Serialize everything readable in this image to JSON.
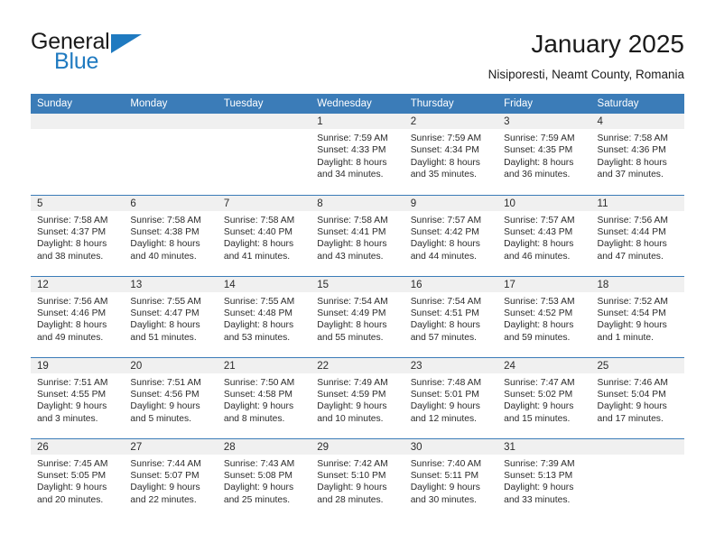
{
  "logo": {
    "word_top": "General",
    "word_bottom": "Blue",
    "flag_icon": "triangle-flag-icon",
    "accent_color": "#1f7ac0"
  },
  "header": {
    "title": "January 2025",
    "subtitle": "Nisiporesti, Neamt County, Romania"
  },
  "theme": {
    "header_blue": "#3b7cb8",
    "daynum_band": "#f0f0f0",
    "text": "#2b2b2b"
  },
  "calendar": {
    "weekday_headers": [
      "Sunday",
      "Monday",
      "Tuesday",
      "Wednesday",
      "Thursday",
      "Friday",
      "Saturday"
    ],
    "weeks": [
      [
        {
          "day": "",
          "lines": []
        },
        {
          "day": "",
          "lines": []
        },
        {
          "day": "",
          "lines": []
        },
        {
          "day": "1",
          "lines": [
            "Sunrise: 7:59 AM",
            "Sunset: 4:33 PM",
            "Daylight: 8 hours",
            "and 34 minutes."
          ]
        },
        {
          "day": "2",
          "lines": [
            "Sunrise: 7:59 AM",
            "Sunset: 4:34 PM",
            "Daylight: 8 hours",
            "and 35 minutes."
          ]
        },
        {
          "day": "3",
          "lines": [
            "Sunrise: 7:59 AM",
            "Sunset: 4:35 PM",
            "Daylight: 8 hours",
            "and 36 minutes."
          ]
        },
        {
          "day": "4",
          "lines": [
            "Sunrise: 7:58 AM",
            "Sunset: 4:36 PM",
            "Daylight: 8 hours",
            "and 37 minutes."
          ]
        }
      ],
      [
        {
          "day": "5",
          "lines": [
            "Sunrise: 7:58 AM",
            "Sunset: 4:37 PM",
            "Daylight: 8 hours",
            "and 38 minutes."
          ]
        },
        {
          "day": "6",
          "lines": [
            "Sunrise: 7:58 AM",
            "Sunset: 4:38 PM",
            "Daylight: 8 hours",
            "and 40 minutes."
          ]
        },
        {
          "day": "7",
          "lines": [
            "Sunrise: 7:58 AM",
            "Sunset: 4:40 PM",
            "Daylight: 8 hours",
            "and 41 minutes."
          ]
        },
        {
          "day": "8",
          "lines": [
            "Sunrise: 7:58 AM",
            "Sunset: 4:41 PM",
            "Daylight: 8 hours",
            "and 43 minutes."
          ]
        },
        {
          "day": "9",
          "lines": [
            "Sunrise: 7:57 AM",
            "Sunset: 4:42 PM",
            "Daylight: 8 hours",
            "and 44 minutes."
          ]
        },
        {
          "day": "10",
          "lines": [
            "Sunrise: 7:57 AM",
            "Sunset: 4:43 PM",
            "Daylight: 8 hours",
            "and 46 minutes."
          ]
        },
        {
          "day": "11",
          "lines": [
            "Sunrise: 7:56 AM",
            "Sunset: 4:44 PM",
            "Daylight: 8 hours",
            "and 47 minutes."
          ]
        }
      ],
      [
        {
          "day": "12",
          "lines": [
            "Sunrise: 7:56 AM",
            "Sunset: 4:46 PM",
            "Daylight: 8 hours",
            "and 49 minutes."
          ]
        },
        {
          "day": "13",
          "lines": [
            "Sunrise: 7:55 AM",
            "Sunset: 4:47 PM",
            "Daylight: 8 hours",
            "and 51 minutes."
          ]
        },
        {
          "day": "14",
          "lines": [
            "Sunrise: 7:55 AM",
            "Sunset: 4:48 PM",
            "Daylight: 8 hours",
            "and 53 minutes."
          ]
        },
        {
          "day": "15",
          "lines": [
            "Sunrise: 7:54 AM",
            "Sunset: 4:49 PM",
            "Daylight: 8 hours",
            "and 55 minutes."
          ]
        },
        {
          "day": "16",
          "lines": [
            "Sunrise: 7:54 AM",
            "Sunset: 4:51 PM",
            "Daylight: 8 hours",
            "and 57 minutes."
          ]
        },
        {
          "day": "17",
          "lines": [
            "Sunrise: 7:53 AM",
            "Sunset: 4:52 PM",
            "Daylight: 8 hours",
            "and 59 minutes."
          ]
        },
        {
          "day": "18",
          "lines": [
            "Sunrise: 7:52 AM",
            "Sunset: 4:54 PM",
            "Daylight: 9 hours",
            "and 1 minute."
          ]
        }
      ],
      [
        {
          "day": "19",
          "lines": [
            "Sunrise: 7:51 AM",
            "Sunset: 4:55 PM",
            "Daylight: 9 hours",
            "and 3 minutes."
          ]
        },
        {
          "day": "20",
          "lines": [
            "Sunrise: 7:51 AM",
            "Sunset: 4:56 PM",
            "Daylight: 9 hours",
            "and 5 minutes."
          ]
        },
        {
          "day": "21",
          "lines": [
            "Sunrise: 7:50 AM",
            "Sunset: 4:58 PM",
            "Daylight: 9 hours",
            "and 8 minutes."
          ]
        },
        {
          "day": "22",
          "lines": [
            "Sunrise: 7:49 AM",
            "Sunset: 4:59 PM",
            "Daylight: 9 hours",
            "and 10 minutes."
          ]
        },
        {
          "day": "23",
          "lines": [
            "Sunrise: 7:48 AM",
            "Sunset: 5:01 PM",
            "Daylight: 9 hours",
            "and 12 minutes."
          ]
        },
        {
          "day": "24",
          "lines": [
            "Sunrise: 7:47 AM",
            "Sunset: 5:02 PM",
            "Daylight: 9 hours",
            "and 15 minutes."
          ]
        },
        {
          "day": "25",
          "lines": [
            "Sunrise: 7:46 AM",
            "Sunset: 5:04 PM",
            "Daylight: 9 hours",
            "and 17 minutes."
          ]
        }
      ],
      [
        {
          "day": "26",
          "lines": [
            "Sunrise: 7:45 AM",
            "Sunset: 5:05 PM",
            "Daylight: 9 hours",
            "and 20 minutes."
          ]
        },
        {
          "day": "27",
          "lines": [
            "Sunrise: 7:44 AM",
            "Sunset: 5:07 PM",
            "Daylight: 9 hours",
            "and 22 minutes."
          ]
        },
        {
          "day": "28",
          "lines": [
            "Sunrise: 7:43 AM",
            "Sunset: 5:08 PM",
            "Daylight: 9 hours",
            "and 25 minutes."
          ]
        },
        {
          "day": "29",
          "lines": [
            "Sunrise: 7:42 AM",
            "Sunset: 5:10 PM",
            "Daylight: 9 hours",
            "and 28 minutes."
          ]
        },
        {
          "day": "30",
          "lines": [
            "Sunrise: 7:40 AM",
            "Sunset: 5:11 PM",
            "Daylight: 9 hours",
            "and 30 minutes."
          ]
        },
        {
          "day": "31",
          "lines": [
            "Sunrise: 7:39 AM",
            "Sunset: 5:13 PM",
            "Daylight: 9 hours",
            "and 33 minutes."
          ]
        },
        {
          "day": "",
          "lines": []
        }
      ]
    ]
  }
}
